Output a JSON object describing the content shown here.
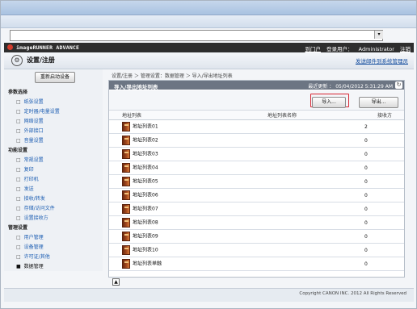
{
  "app": {
    "brand": "imageRUNNER ADVANCE",
    "user_prefix": "到门户",
    "user_label": "登录用户：",
    "user_name": "Administrator",
    "logout": "注销",
    "settings_title": "设置/注册",
    "settings_link": "发送邮件到系统管理员"
  },
  "left": {
    "restart_button": "重新启动设备",
    "sections": [
      {
        "title": "参数选择",
        "items": [
          "纸张设置",
          "定时器/电量设置",
          "网络设置",
          "外部接口",
          "音量设置"
        ]
      },
      {
        "title": "功能设置",
        "items": [
          "常规设置",
          "复印",
          "打印机",
          "发送",
          "接收/转发",
          "存储/访问文件"
        ]
      },
      {
        "title": "",
        "items": [
          "设置接收方"
        ]
      },
      {
        "title": "管理设置",
        "items": [
          "用户管理",
          "设备管理",
          "许可证/其他",
          "数据管理"
        ]
      }
    ]
  },
  "main": {
    "breadcrumb": "设置/注册 ＞ 管理设置：数据管理 ＞ 导入/导出地址列表",
    "panel_title": "导入/导出地址列表",
    "last_updated": "最近更新 ： 05/04/2012 5:31:29 AM",
    "buttons": {
      "import": "导入...",
      "export": "导出..."
    },
    "headers": {
      "list": "地址列表",
      "name": "地址列表名称",
      "count": "接收方"
    },
    "rows": [
      {
        "list": "地址列表01",
        "name": "",
        "count": "2"
      },
      {
        "list": "地址列表02",
        "name": "",
        "count": "0"
      },
      {
        "list": "地址列表03",
        "name": "",
        "count": "0"
      },
      {
        "list": "地址列表04",
        "name": "",
        "count": "0"
      },
      {
        "list": "地址列表05",
        "name": "",
        "count": "0"
      },
      {
        "list": "地址列表06",
        "name": "",
        "count": "0"
      },
      {
        "list": "地址列表07",
        "name": "",
        "count": "0"
      },
      {
        "list": "地址列表08",
        "name": "",
        "count": "0"
      },
      {
        "list": "地址列表09",
        "name": "",
        "count": "0"
      },
      {
        "list": "地址列表10",
        "name": "",
        "count": "0"
      },
      {
        "list": "地址列表单触",
        "name": "",
        "count": "0"
      }
    ]
  },
  "footer": {
    "copyright": "Copyright CANON INC. 2012 All Rights Reserved"
  },
  "colors": {
    "accent": "#d5232e",
    "header": "#2e2e2e",
    "panel_head": "#6c7583",
    "link": "#1b5db2"
  }
}
